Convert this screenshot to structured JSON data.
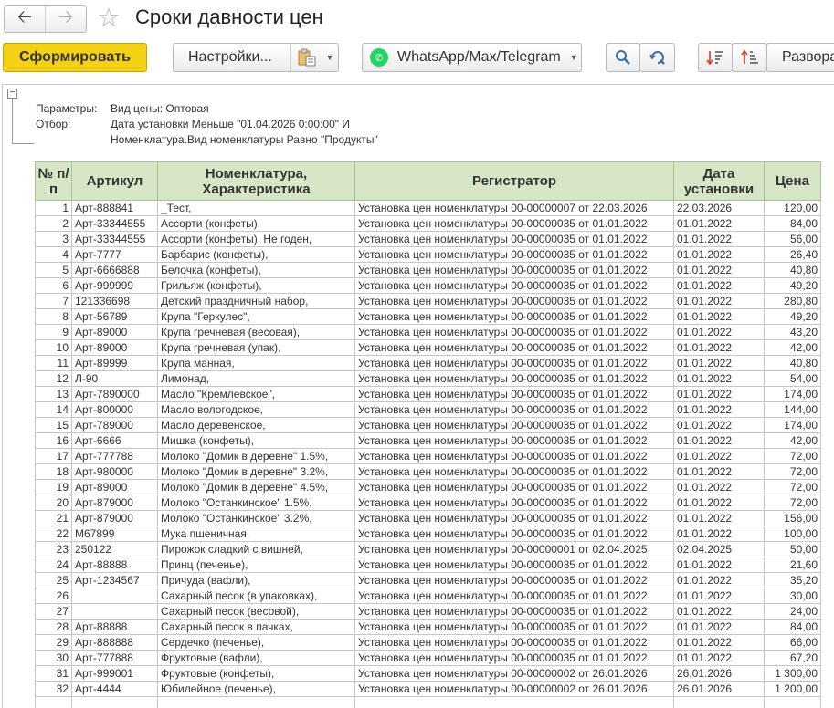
{
  "window": {
    "title": "Сроки давности цен",
    "back_icon": "arrow-left",
    "forward_icon": "arrow-right",
    "favorite_icon": "star"
  },
  "toolbar": {
    "generate_label": "Сформировать",
    "settings_label": "Настройки...",
    "messenger_label": "WhatsApp/Max/Telegram",
    "expand_label": "Развора"
  },
  "params": {
    "params_label": "Параметры:",
    "params_value": "Вид цены: Оптовая",
    "filter_label": "Отбор:",
    "filter_line1": "Дата установки Меньше \"01.04.2026 0:00:00\" И",
    "filter_line2": "Номенклатура.Вид номенклатуры Равно \"Продукты\""
  },
  "table": {
    "headers": {
      "num": "№ п/п",
      "article": "Артикул",
      "item": "Номенклатура, Характеристика",
      "registrar": "Регистратор",
      "date": "Дата установки",
      "price": "Цена"
    },
    "rows": [
      [
        "1",
        "Арт-888841",
        "_Тест,",
        "Установка цен номенклатуры 00-00000007 от 22.03.2026",
        "22.03.2026",
        "120,00"
      ],
      [
        "2",
        "Арт-33344555",
        "Ассорти (конфеты),",
        "Установка цен номенклатуры 00-00000035 от 01.01.2022",
        "01.01.2022",
        "84,00"
      ],
      [
        "3",
        "Арт-33344555",
        "Ассорти (конфеты), Не годен,",
        "Установка цен номенклатуры 00-00000035 от 01.01.2022",
        "01.01.2022",
        "56,00"
      ],
      [
        "4",
        "Арт-7777",
        "Барбарис (конфеты),",
        "Установка цен номенклатуры 00-00000035 от 01.01.2022",
        "01.01.2022",
        "26,40"
      ],
      [
        "5",
        "Арт-6666888",
        "Белочка (конфеты),",
        "Установка цен номенклатуры 00-00000035 от 01.01.2022",
        "01.01.2022",
        "40,80"
      ],
      [
        "6",
        "Арт-999999",
        "Грильяж (конфеты),",
        "Установка цен номенклатуры 00-00000035 от 01.01.2022",
        "01.01.2022",
        "49,20"
      ],
      [
        "7",
        "121336698",
        "Детский праздничный набор,",
        "Установка цен номенклатуры 00-00000035 от 01.01.2022",
        "01.01.2022",
        "280,80"
      ],
      [
        "8",
        "Арт-56789",
        "Крупа \"Геркулес\",",
        "Установка цен номенклатуры 00-00000035 от 01.01.2022",
        "01.01.2022",
        "49,20"
      ],
      [
        "9",
        "Арт-89000",
        "Крупа гречневая (весовая),",
        "Установка цен номенклатуры 00-00000035 от 01.01.2022",
        "01.01.2022",
        "43,20"
      ],
      [
        "10",
        "Арт-89000",
        "Крупа гречневая (упак),",
        "Установка цен номенклатуры 00-00000035 от 01.01.2022",
        "01.01.2022",
        "42,00"
      ],
      [
        "11",
        "Арт-89999",
        "Крупа манная,",
        "Установка цен номенклатуры 00-00000035 от 01.01.2022",
        "01.01.2022",
        "40,80"
      ],
      [
        "12",
        "Л-90",
        "Лимонад,",
        "Установка цен номенклатуры 00-00000035 от 01.01.2022",
        "01.01.2022",
        "54,00"
      ],
      [
        "13",
        "Арт-7890000",
        "Масло \"Кремлевское\",",
        "Установка цен номенклатуры 00-00000035 от 01.01.2022",
        "01.01.2022",
        "174,00"
      ],
      [
        "14",
        "Арт-800000",
        "Масло вологодское,",
        "Установка цен номенклатуры 00-00000035 от 01.01.2022",
        "01.01.2022",
        "144,00"
      ],
      [
        "15",
        "Арт-789000",
        "Масло деревенское,",
        "Установка цен номенклатуры 00-00000035 от 01.01.2022",
        "01.01.2022",
        "174,00"
      ],
      [
        "16",
        "Арт-6666",
        "Мишка (конфеты),",
        "Установка цен номенклатуры 00-00000035 от 01.01.2022",
        "01.01.2022",
        "42,00"
      ],
      [
        "17",
        "Арт-777788",
        "Молоко \"Домик в деревне\" 1.5%,",
        "Установка цен номенклатуры 00-00000035 от 01.01.2022",
        "01.01.2022",
        "72,00"
      ],
      [
        "18",
        "Арт-980000",
        "Молоко \"Домик в деревне\" 3.2%,",
        "Установка цен номенклатуры 00-00000035 от 01.01.2022",
        "01.01.2022",
        "72,00"
      ],
      [
        "19",
        "Арт-89000",
        "Молоко \"Домик в деревне\" 4.5%,",
        "Установка цен номенклатуры 00-00000035 от 01.01.2022",
        "01.01.2022",
        "72,00"
      ],
      [
        "20",
        "Арт-879000",
        "Молоко \"Останкинское\" 1.5%,",
        "Установка цен номенклатуры 00-00000035 от 01.01.2022",
        "01.01.2022",
        "72,00"
      ],
      [
        "21",
        "Арт-879000",
        "Молоко \"Останкинское\" 3.2%,",
        "Установка цен номенклатуры 00-00000035 от 01.01.2022",
        "01.01.2022",
        "156,00"
      ],
      [
        "22",
        "M67899",
        "Мука пшеничная,",
        "Установка цен номенклатуры 00-00000035 от 01.01.2022",
        "01.01.2022",
        "100,00"
      ],
      [
        "23",
        "250122",
        "Пирожок сладкий с вишней,",
        "Установка цен номенклатуры 00-00000001 от 02.04.2025",
        "02.04.2025",
        "50,00"
      ],
      [
        "24",
        "Арт-88888",
        "Принц (печенье),",
        "Установка цен номенклатуры 00-00000035 от 01.01.2022",
        "01.01.2022",
        "21,60"
      ],
      [
        "25",
        "Арт-1234567",
        "Причуда (вафли),",
        "Установка цен номенклатуры 00-00000035 от 01.01.2022",
        "01.01.2022",
        "35,20"
      ],
      [
        "26",
        "",
        "Сахарный песок (в упаковках),",
        "Установка цен номенклатуры 00-00000035 от 01.01.2022",
        "01.01.2022",
        "30,00"
      ],
      [
        "27",
        "",
        "Сахарный песок (весовой),",
        "Установка цен номенклатуры 00-00000035 от 01.01.2022",
        "01.01.2022",
        "24,00"
      ],
      [
        "28",
        "Арт-88888",
        "Сахарный песок в пачках,",
        "Установка цен номенклатуры 00-00000035 от 01.01.2022",
        "01.01.2022",
        "84,00"
      ],
      [
        "29",
        "Арт-888888",
        "Сердечко (печенье),",
        "Установка цен номенклатуры 00-00000035 от 01.01.2022",
        "01.01.2022",
        "66,00"
      ],
      [
        "30",
        "Арт-777888",
        "Фруктовые (вафли),",
        "Установка цен номенклатуры 00-00000035 от 01.01.2022",
        "01.01.2022",
        "67,20"
      ],
      [
        "31",
        "Арт-999001",
        "Фруктовые (конфеты),",
        "Установка цен номенклатуры 00-00000002 от 26.01.2026",
        "26.01.2026",
        "1 300,00"
      ],
      [
        "32",
        "Арт-4444",
        "Юбилейное (печенье),",
        "Установка цен номенклатуры 00-00000002 от 26.01.2026",
        "26.01.2026",
        "1 200,00"
      ]
    ]
  },
  "colors": {
    "primary_button": "#f5d116",
    "header_bg": "#d6e6c6",
    "whatsapp": "#25d366"
  }
}
